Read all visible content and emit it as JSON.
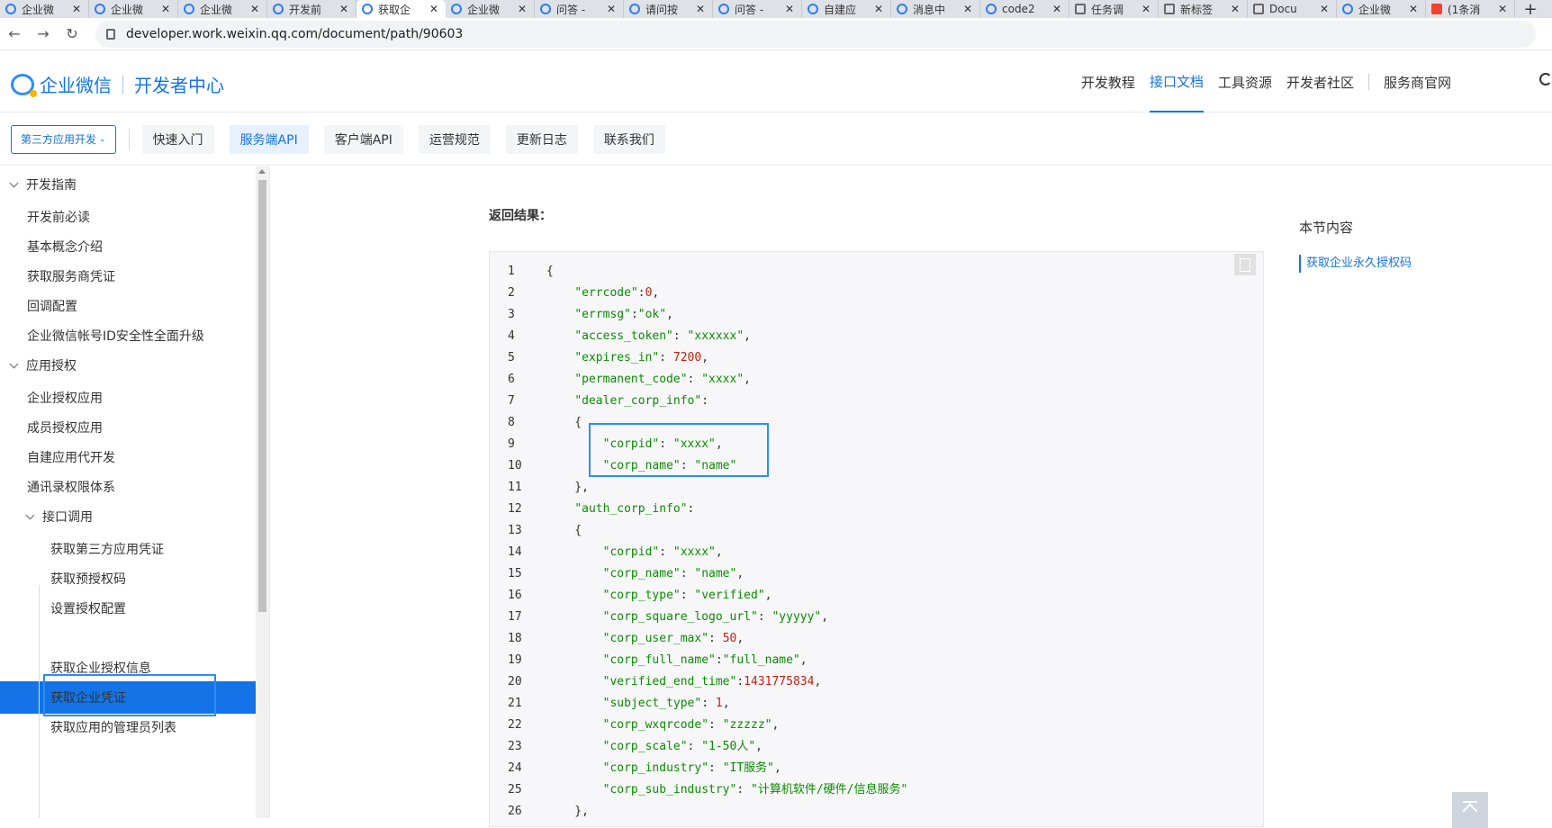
{
  "browser": {
    "tabs": [
      {
        "title": "企业微",
        "icon": "wecom-icon"
      },
      {
        "title": "企业微",
        "icon": "wecom-icon"
      },
      {
        "title": "企业微",
        "icon": "wecom-icon"
      },
      {
        "title": "开发前",
        "icon": "wecom-icon"
      },
      {
        "title": "获取企",
        "icon": "wecom-icon",
        "active": true
      },
      {
        "title": "企业微",
        "icon": "wecom-icon"
      },
      {
        "title": "问答 -",
        "icon": "wecom-icon"
      },
      {
        "title": "请问按",
        "icon": "wecom-icon"
      },
      {
        "title": "问答 -",
        "icon": "wecom-icon"
      },
      {
        "title": "自建应",
        "icon": "wecom-icon"
      },
      {
        "title": "消息中",
        "icon": "wecom-icon"
      },
      {
        "title": "code2",
        "icon": "wecom-icon"
      },
      {
        "title": "任务调",
        "icon": "task-icon"
      },
      {
        "title": "新标签",
        "icon": "globe-icon"
      },
      {
        "title": "Docu",
        "icon": "doc-icon"
      },
      {
        "title": "企业微",
        "icon": "baidu-icon"
      },
      {
        "title": "(1条消",
        "icon": "csdn-icon"
      }
    ],
    "close_glyph": "✕",
    "new_tab_glyph": "+",
    "url": "developer.work.weixin.qq.com/document/path/90603"
  },
  "header": {
    "logo_text": "企业微信",
    "logo_subtitle": "开发者中心",
    "nav": [
      "开发教程",
      "接口文档",
      "工具资源",
      "开发者社区",
      "服务商官网"
    ],
    "nav_active": "接口文档"
  },
  "subnav": {
    "dropdown": "第三方应用开发",
    "buttons": [
      "快速入门",
      "服务端API",
      "客户端API",
      "运营规范",
      "更新日志",
      "联系我们"
    ],
    "active": "服务端API"
  },
  "sidebar": {
    "items": [
      {
        "label": "开发指南",
        "level": "sec"
      },
      {
        "label": "开发前必读",
        "level": "lv1"
      },
      {
        "label": "基本概念介绍",
        "level": "lv1"
      },
      {
        "label": "获取服务商凭证",
        "level": "lv1"
      },
      {
        "label": "回调配置",
        "level": "lv1"
      },
      {
        "label": "企业微信帐号ID安全性全面升级",
        "level": "lv1"
      },
      {
        "label": "应用授权",
        "level": "sec"
      },
      {
        "label": "企业授权应用",
        "level": "lv1"
      },
      {
        "label": "成员授权应用",
        "level": "lv1"
      },
      {
        "label": "自建应用代开发",
        "level": "lv1"
      },
      {
        "label": "通讯录权限体系",
        "level": "lv1"
      },
      {
        "label": "接口调用",
        "level": "lv1sec"
      },
      {
        "label": "获取第三方应用凭证",
        "level": "lv2"
      },
      {
        "label": "获取预授权码",
        "level": "lv2"
      },
      {
        "label": "设置授权配置",
        "level": "lv2"
      },
      {
        "label": "获取企业永久授权码",
        "level": "lv2",
        "selected": true
      },
      {
        "label": "获取企业授权信息",
        "level": "lv2"
      },
      {
        "label": "获取企业凭证",
        "level": "lv2"
      },
      {
        "label": "获取应用的管理员列表",
        "level": "lv2"
      }
    ]
  },
  "content": {
    "return_label": "返回结果：",
    "code": [
      [
        [
          "p",
          "{"
        ]
      ],
      [
        [
          "p",
          "    "
        ],
        [
          "k",
          "\"errcode\""
        ],
        [
          "p",
          ":"
        ],
        [
          "n",
          "0"
        ],
        [
          "p",
          ","
        ]
      ],
      [
        [
          "p",
          "    "
        ],
        [
          "k",
          "\"errmsg\""
        ],
        [
          "p",
          ":"
        ],
        [
          "k",
          "\"ok\""
        ],
        [
          "p",
          ","
        ]
      ],
      [
        [
          "p",
          "    "
        ],
        [
          "k",
          "\"access_token\""
        ],
        [
          "p",
          ": "
        ],
        [
          "k",
          "\"xxxxxx\""
        ],
        [
          "p",
          ","
        ]
      ],
      [
        [
          "p",
          "    "
        ],
        [
          "k",
          "\"expires_in\""
        ],
        [
          "p",
          ": "
        ],
        [
          "n",
          "7200"
        ],
        [
          "p",
          ","
        ]
      ],
      [
        [
          "p",
          "    "
        ],
        [
          "k",
          "\"permanent_code\""
        ],
        [
          "p",
          ": "
        ],
        [
          "k",
          "\"xxxx\""
        ],
        [
          "p",
          ","
        ]
      ],
      [
        [
          "p",
          "    "
        ],
        [
          "k",
          "\"dealer_corp_info\""
        ],
        [
          "p",
          ":"
        ]
      ],
      [
        [
          "p",
          "    {"
        ]
      ],
      [
        [
          "p",
          "        "
        ],
        [
          "k",
          "\"corpid\""
        ],
        [
          "p",
          ": "
        ],
        [
          "k",
          "\"xxxx\""
        ],
        [
          "p",
          ","
        ]
      ],
      [
        [
          "p",
          "        "
        ],
        [
          "k",
          "\"corp_name\""
        ],
        [
          "p",
          ": "
        ],
        [
          "k",
          "\"name\""
        ]
      ],
      [
        [
          "p",
          "    },"
        ]
      ],
      [
        [
          "p",
          "    "
        ],
        [
          "k",
          "\"auth_corp_info\""
        ],
        [
          "p",
          ":"
        ]
      ],
      [
        [
          "p",
          "    {"
        ]
      ],
      [
        [
          "p",
          "        "
        ],
        [
          "k",
          "\"corpid\""
        ],
        [
          "p",
          ": "
        ],
        [
          "k",
          "\"xxxx\""
        ],
        [
          "p",
          ","
        ]
      ],
      [
        [
          "p",
          "        "
        ],
        [
          "k",
          "\"corp_name\""
        ],
        [
          "p",
          ": "
        ],
        [
          "k",
          "\"name\""
        ],
        [
          "p",
          ","
        ]
      ],
      [
        [
          "p",
          "        "
        ],
        [
          "k",
          "\"corp_type\""
        ],
        [
          "p",
          ": "
        ],
        [
          "k",
          "\"verified\""
        ],
        [
          "p",
          ","
        ]
      ],
      [
        [
          "p",
          "        "
        ],
        [
          "k",
          "\"corp_square_logo_url\""
        ],
        [
          "p",
          ": "
        ],
        [
          "k",
          "\"yyyyy\""
        ],
        [
          "p",
          ","
        ]
      ],
      [
        [
          "p",
          "        "
        ],
        [
          "k",
          "\"corp_user_max\""
        ],
        [
          "p",
          ": "
        ],
        [
          "n",
          "50"
        ],
        [
          "p",
          ","
        ]
      ],
      [
        [
          "p",
          "        "
        ],
        [
          "k",
          "\"corp_full_name\""
        ],
        [
          "p",
          ":"
        ],
        [
          "k",
          "\"full_name\""
        ],
        [
          "p",
          ","
        ]
      ],
      [
        [
          "p",
          "        "
        ],
        [
          "k",
          "\"verified_end_time\""
        ],
        [
          "p",
          ":"
        ],
        [
          "n",
          "1431775834"
        ],
        [
          "p",
          ","
        ]
      ],
      [
        [
          "p",
          "        "
        ],
        [
          "k",
          "\"subject_type\""
        ],
        [
          "p",
          ": "
        ],
        [
          "n",
          "1"
        ],
        [
          "p",
          ","
        ]
      ],
      [
        [
          "p",
          "        "
        ],
        [
          "k",
          "\"corp_wxqrcode\""
        ],
        [
          "p",
          ": "
        ],
        [
          "k",
          "\"zzzzz\""
        ],
        [
          "p",
          ","
        ]
      ],
      [
        [
          "p",
          "        "
        ],
        [
          "k",
          "\"corp_scale\""
        ],
        [
          "p",
          ": "
        ],
        [
          "k",
          "\"1-50人\""
        ],
        [
          "p",
          ","
        ]
      ],
      [
        [
          "p",
          "        "
        ],
        [
          "k",
          "\"corp_industry\""
        ],
        [
          "p",
          ": "
        ],
        [
          "k",
          "\"IT服务\""
        ],
        [
          "p",
          ","
        ]
      ],
      [
        [
          "p",
          "        "
        ],
        [
          "k",
          "\"corp_sub_industry\""
        ],
        [
          "p",
          ": "
        ],
        [
          "k",
          "\"计算机软件/硬件/信息服务\""
        ]
      ],
      [
        [
          "p",
          "    },"
        ]
      ]
    ]
  },
  "toc": {
    "title": "本节内容",
    "items": [
      "获取企业永久授权码"
    ]
  },
  "colors": {
    "accent": "#1473e6",
    "highlight": "#2a8ef5",
    "string": "#0a8c00",
    "number": "#c91d10"
  }
}
